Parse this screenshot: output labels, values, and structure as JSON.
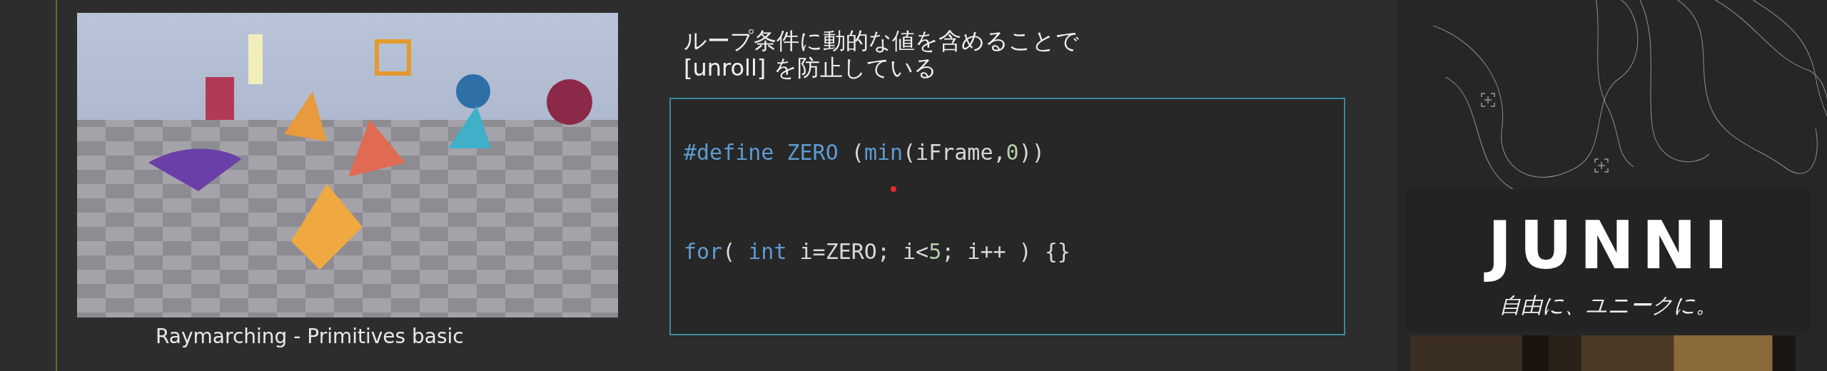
{
  "slide": {
    "heading_lines": [
      "ループ条件に動的な値を含めることで",
      "[unroll] を防止している"
    ],
    "code_lines": [
      [
        {
          "text": "#define ZERO",
          "kind": "keyword"
        },
        {
          "text": " (",
          "kind": "plain"
        },
        {
          "text": "min",
          "kind": "keyword"
        },
        {
          "text": "(iFrame,",
          "kind": "plain"
        },
        {
          "text": "0",
          "kind": "number"
        },
        {
          "text": "))",
          "kind": "plain"
        }
      ],
      [
        {
          "text": "for",
          "kind": "keyword"
        },
        {
          "text": "( ",
          "kind": "plain"
        },
        {
          "text": "int",
          "kind": "keyword"
        },
        {
          "text": " i=ZERO; i<",
          "kind": "plain"
        },
        {
          "text": "5",
          "kind": "number"
        },
        {
          "text": "; i++ ) {}",
          "kind": "plain"
        }
      ]
    ],
    "caption": "Raymarching - Primitives basic"
  },
  "brand": {
    "logo": "JUNNI",
    "tagline": "自由に、ユニークに。"
  }
}
